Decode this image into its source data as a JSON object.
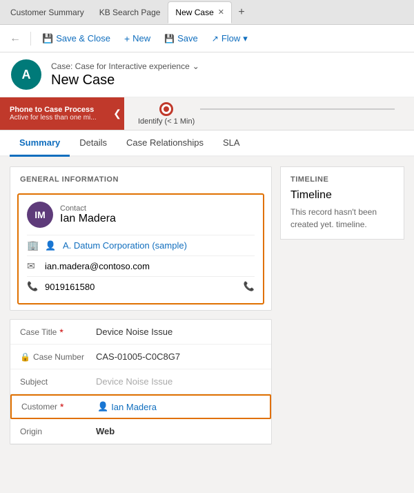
{
  "tabs": [
    {
      "label": "Customer Summary",
      "active": false,
      "closeable": false
    },
    {
      "label": "KB Search Page",
      "active": false,
      "closeable": false
    },
    {
      "label": "New Case",
      "active": true,
      "closeable": true
    }
  ],
  "toolbar": {
    "back_icon": "←",
    "save_close_label": "Save & Close",
    "new_label": "New",
    "save_label": "Save",
    "flow_label": "Flow",
    "dropdown_icon": "▾"
  },
  "header": {
    "breadcrumb": "Case: Case for Interactive experience",
    "breadcrumb_icon": "⌄",
    "title": "New Case",
    "avatar_initials": "A"
  },
  "process_bar": {
    "phase_title": "Phone to Case Process",
    "phase_subtitle": "Active for less than one mi...",
    "step_label": "Identify",
    "step_time": "(< 1 Min)",
    "collapse_icon": "❮"
  },
  "nav_tabs": [
    {
      "label": "Summary",
      "active": true
    },
    {
      "label": "Details",
      "active": false
    },
    {
      "label": "Case Relationships",
      "active": false
    },
    {
      "label": "SLA",
      "active": false
    }
  ],
  "general_info": {
    "section_title": "GENERAL INFORMATION",
    "contact": {
      "label": "Contact",
      "avatar_initials": "IM",
      "name": "Ian Madera",
      "company": "A. Datum Corporation (sample)",
      "email": "ian.madera@contoso.com",
      "phone": "9019161580"
    }
  },
  "form_fields": [
    {
      "label": "Case Title",
      "required": true,
      "value": "Device Noise Issue",
      "type": "text",
      "locked": false
    },
    {
      "label": "Case Number",
      "required": false,
      "value": "CAS-01005-C0C8G7",
      "type": "text",
      "locked": true
    },
    {
      "label": "Subject",
      "required": false,
      "value": "Device Noise Issue",
      "type": "text",
      "locked": false
    },
    {
      "label": "Customer",
      "required": true,
      "value": "Ian Madera",
      "type": "link",
      "locked": false,
      "highlighted": true
    },
    {
      "label": "Origin",
      "required": false,
      "value": "Web",
      "type": "bold",
      "locked": false
    }
  ],
  "timeline": {
    "section_title": "TIMELINE",
    "heading": "Timeline",
    "empty_text": "This record hasn't been created yet. timeline."
  },
  "icons": {
    "building": "🏢",
    "email": "✉",
    "phone": "📞",
    "phone_end": "📞",
    "lock": "🔒",
    "contact_icon": "👤",
    "chevron": "⌄",
    "plus": "+"
  }
}
